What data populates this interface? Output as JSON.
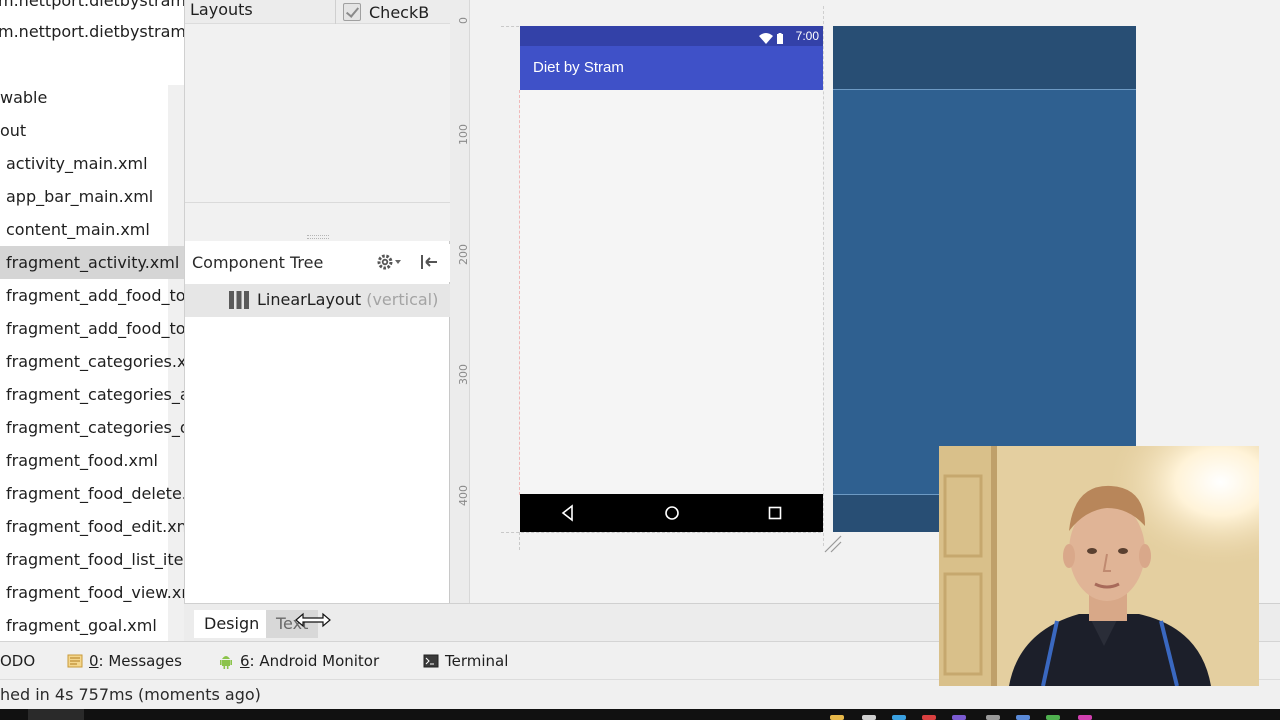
{
  "project_tree": {
    "items": [
      {
        "label": "m.nettport.dietbystram."
      },
      {
        "label": "m.nettport.dietbystram."
      },
      {
        "label": "wable"
      },
      {
        "label": "out"
      },
      {
        "label": "activity_main.xml"
      },
      {
        "label": "app_bar_main.xml"
      },
      {
        "label": "content_main.xml"
      },
      {
        "label": "fragment_activity.xml",
        "selected": true
      },
      {
        "label": "fragment_add_food_to"
      },
      {
        "label": "fragment_add_food_to"
      },
      {
        "label": "fragment_categories.xn"
      },
      {
        "label": "fragment_categories_a"
      },
      {
        "label": "fragment_categories_d"
      },
      {
        "label": "fragment_food.xml"
      },
      {
        "label": "fragment_food_delete."
      },
      {
        "label": "fragment_food_edit.xn"
      },
      {
        "label": "fragment_food_list_iter"
      },
      {
        "label": "fragment_food_view.xn"
      },
      {
        "label": "fragment_goal.xml"
      }
    ]
  },
  "palette": {
    "group_label": "Layouts",
    "checkbox_item": "CheckB"
  },
  "component_tree": {
    "title": "Component Tree",
    "row_label": "LinearLayout",
    "row_hint": "(vertical)"
  },
  "ruler": {
    "labels": [
      "0",
      "100",
      "200",
      "300",
      "400"
    ]
  },
  "preview": {
    "status_time": "7:00",
    "app_title": "Diet by Stram",
    "colors": {
      "primary": "#3f51c8",
      "primary_dark": "#3341a8",
      "blueprint": "#2f6090"
    }
  },
  "editor_tabs": {
    "design": "Design",
    "text": "Text"
  },
  "tool_windows": {
    "todo": "ODO",
    "messages_num": "0",
    "messages_label": ": Messages",
    "android_num": "6",
    "android_label": ": Android Monitor",
    "terminal": "Terminal"
  },
  "status_bar": {
    "text": "hed in 4s 757ms (moments ago)"
  }
}
